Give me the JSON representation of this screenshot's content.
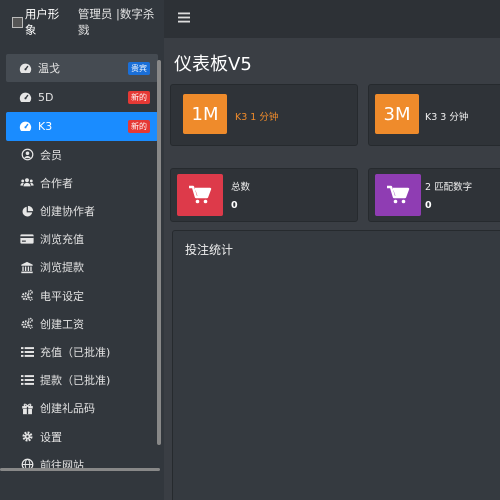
{
  "brand": {
    "title": "用户形象",
    "role": "管理员 |数字杀戮"
  },
  "sidebar": {
    "items": [
      {
        "label": "温戈",
        "icon": "tachometer-icon",
        "badge": "贵宾",
        "badge_color": "#1a6fd8"
      },
      {
        "label": "5D",
        "icon": "tachometer-icon",
        "badge": "新的",
        "badge_color": "#e53935"
      },
      {
        "label": "K3",
        "icon": "tachometer-icon",
        "badge": "新的",
        "badge_color": "#e53935"
      },
      {
        "label": "会员",
        "icon": "user-circle-icon"
      },
      {
        "label": "合作者",
        "icon": "users-icon"
      },
      {
        "label": "创建协作者",
        "icon": "pie-chart-icon"
      },
      {
        "label": "浏览充值",
        "icon": "credit-card-icon"
      },
      {
        "label": "浏览提款",
        "icon": "bank-icon"
      },
      {
        "label": "电平设定",
        "icon": "cogs-icon"
      },
      {
        "label": "创建工资",
        "icon": "cogs-icon"
      },
      {
        "label": "充值（已批准)",
        "icon": "list-icon"
      },
      {
        "label": "提款（已批准)",
        "icon": "list-icon"
      },
      {
        "label": "创建礼品码",
        "icon": "gift-icon"
      },
      {
        "label": "设置",
        "icon": "gear-icon"
      },
      {
        "label": "前往网站",
        "icon": "globe-icon"
      }
    ]
  },
  "main": {
    "title": "仪表板V5",
    "cards": [
      {
        "box": "1M",
        "label": "K3 1 分钟"
      },
      {
        "box": "3M",
        "label": "K3 3 分钟"
      },
      {
        "label": "总数",
        "value": "0"
      },
      {
        "label": "2 匹配数字",
        "value": "0"
      }
    ],
    "stats_title": "投注统计"
  },
  "colors": {
    "active": "#1a8cff",
    "orange": "#ef8b2b",
    "red": "#dd3a4a",
    "purple": "#8f3db3"
  }
}
